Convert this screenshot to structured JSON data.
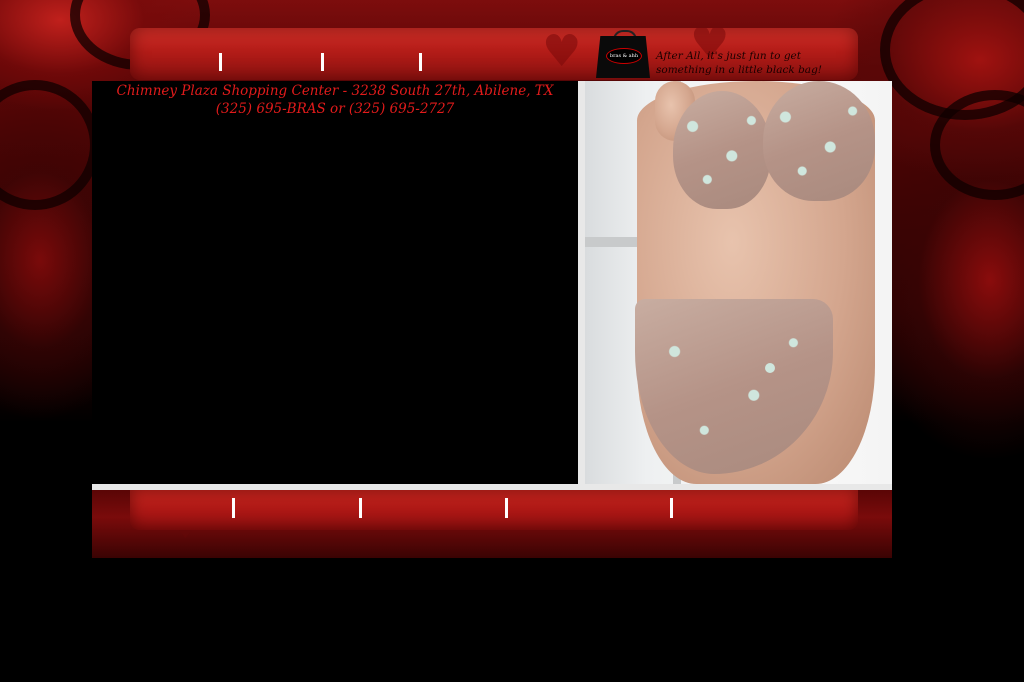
{
  "header": {
    "nav_links": [
      "",
      "",
      "",
      ""
    ],
    "logo_text": "bras & ahh",
    "tagline_line1": "After All, it's just fun to get",
    "tagline_line2": "something in a little black bag!"
  },
  "main": {
    "address_line1": "Chimney Plaza Shopping Center - 3238 South 27th, Abilene, TX",
    "address_line2": "(325) 695-BRAS or (325) 695-2727",
    "photo_icon": "lingerie-model-photo"
  },
  "footer": {
    "nav_links": [
      "",
      "",
      "",
      "",
      ""
    ]
  },
  "colors": {
    "accent_red": "#e11b1b",
    "band_red": "#b31c18",
    "background": "#000000"
  }
}
